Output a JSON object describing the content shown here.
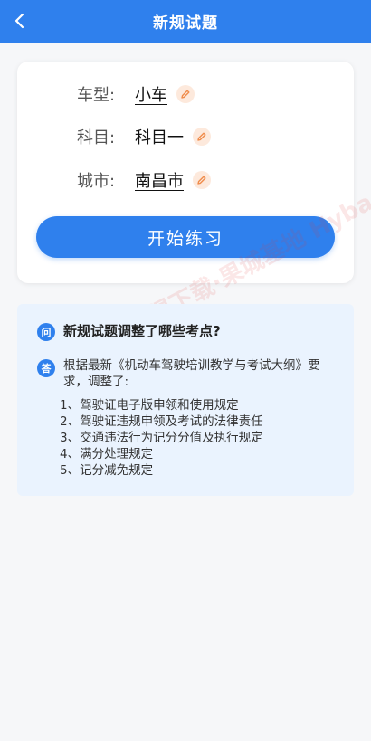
{
  "header": {
    "title": "新规试题"
  },
  "settings": [
    {
      "label": "车型:",
      "value": "小车"
    },
    {
      "label": "科目:",
      "value": "科目一"
    },
    {
      "label": "城市:",
      "value": "南昌市"
    }
  ],
  "start_button": {
    "label": "开始练习"
  },
  "watermark": {
    "text": "记得下载·果城基地 Hybase.com"
  },
  "qa": {
    "q_badge": "问",
    "question": "新规试题调整了哪些考点?",
    "a_badge": "答",
    "answer_intro": "根据最新《机动车驾驶培训教学与考试大纲》要求，调整了:",
    "items": [
      "1、驾驶证电子版申领和使用规定",
      "2、驾驶证违规申领及考试的法律责任",
      "3、交通违法行为记分分值及执行规定",
      "4、满分处理规定",
      "5、记分减免规定"
    ]
  },
  "colors": {
    "primary": "#2f80ed",
    "edit_bg": "#fde9dc",
    "edit_icon": "#f08c4b",
    "qa_bg": "#eaf3fe"
  }
}
